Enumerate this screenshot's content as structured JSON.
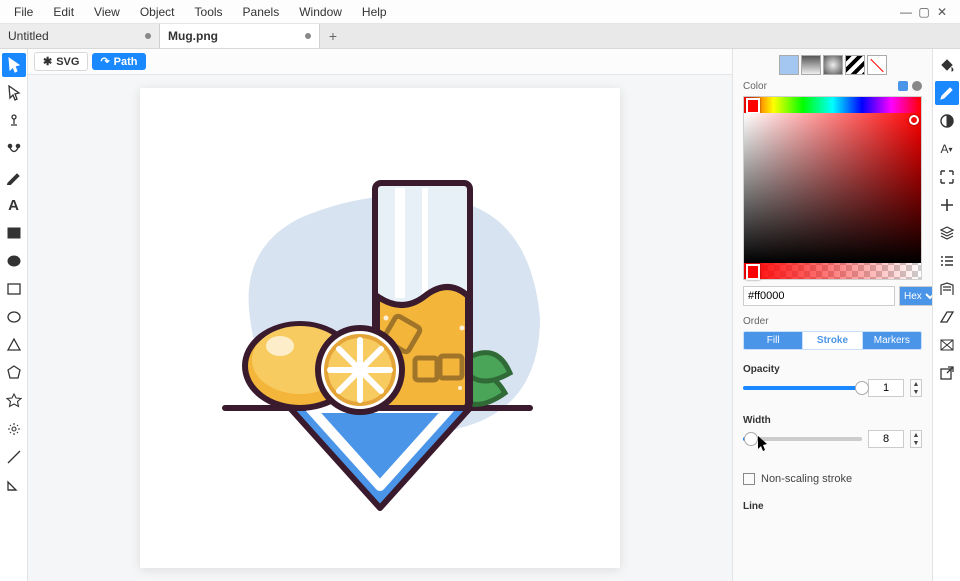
{
  "menu": {
    "items": [
      "File",
      "Edit",
      "View",
      "Object",
      "Tools",
      "Panels",
      "Window",
      "Help"
    ]
  },
  "window_controls": {
    "minimize": "—",
    "maximize": "▢",
    "close": "✕"
  },
  "tabs": [
    {
      "label": "Untitled",
      "dirty": true,
      "active": false
    },
    {
      "label": "Mug.png",
      "dirty": true,
      "active": true
    }
  ],
  "tab_new": "+",
  "canvas_modes": {
    "svg": "SVG",
    "path": "Path"
  },
  "left_tools": [
    "select-tool",
    "direct-select-tool",
    "node-tool",
    "curve-tool",
    "pen-tool",
    "text-tool",
    "rectangle-tool",
    "ellipse-tool",
    "rect-outline-tool",
    "ellipse-outline-tool",
    "triangle-tool",
    "polygon-tool",
    "star-tool",
    "spiral-tool",
    "line-tool",
    "arc-tool"
  ],
  "right_tools": [
    "paint-bucket-icon",
    "brush-icon",
    "contrast-icon",
    "type-panel-icon",
    "focus-icon",
    "add-icon",
    "layers-icon",
    "list-icon",
    "library-icon",
    "skew-icon",
    "distort-icon",
    "export-icon"
  ],
  "swatches": {
    "label": "Color",
    "modes": [
      "flat",
      "linear",
      "radial",
      "pattern",
      "none"
    ]
  },
  "color": {
    "hex": "#ff0000",
    "format": "Hex"
  },
  "order": {
    "label": "Order",
    "options": [
      "Fill",
      "Stroke",
      "Markers"
    ],
    "selected": "Stroke"
  },
  "opacity": {
    "label": "Opacity",
    "value": "1",
    "pct": 100
  },
  "width": {
    "label": "Width",
    "value": "8",
    "pct": 7
  },
  "non_scaling": {
    "label": "Non-scaling stroke",
    "checked": false
  },
  "line": {
    "label": "Line"
  }
}
